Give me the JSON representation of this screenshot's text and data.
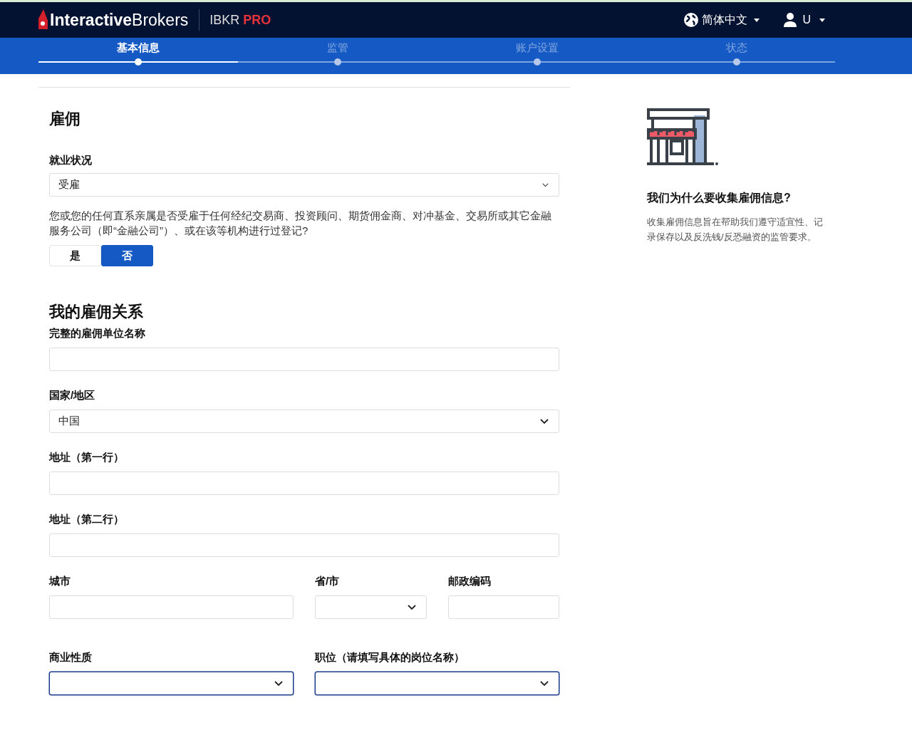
{
  "header": {
    "logo": {
      "part1": "Interactive",
      "part2": "Brokers"
    },
    "product": {
      "name": "IBKR",
      "tier": "PRO"
    },
    "language": "简体中文",
    "user": "U"
  },
  "steps": {
    "progress": {
      "level": 0.25
    },
    "items": [
      {
        "label": "基本信息",
        "selected": true
      },
      {
        "label": "监管",
        "selected": false
      },
      {
        "label": "账户设置",
        "selected": false
      },
      {
        "label": "状态",
        "selected": false
      }
    ]
  },
  "employment": {
    "title": "雇佣",
    "status_label": "就业状况",
    "status_value": "受雇",
    "question": "您或您的任何直系亲属是否受雇于任何经纪交易商、投资顾问、期货佣金商、对冲基金、交易所或其它金融服务公司（即“金融公司”）、或在该等机构进行过登记?",
    "answers": [
      {
        "label": "是",
        "selected": false
      },
      {
        "label": "否",
        "selected": true
      }
    ]
  },
  "relationship": {
    "title": "我的雇佣关系",
    "rows": [
      [
        {
          "label": "完整的雇佣单位名称",
          "kind": "text",
          "highlighted": false
        }
      ],
      [
        {
          "label": "国家/地区",
          "kind": "select",
          "value": "中国",
          "highlighted": false
        }
      ],
      [
        {
          "label": "地址（第一行）",
          "kind": "text",
          "highlighted": false
        }
      ],
      [
        {
          "label": "地址（第二行）",
          "kind": "text",
          "highlighted": false
        }
      ],
      [
        {
          "label": "城市",
          "kind": "text",
          "highlighted": false
        },
        {
          "label": "省/市",
          "kind": "select",
          "highlighted": false
        },
        {
          "label": "邮政编码",
          "kind": "text",
          "highlighted": false
        }
      ],
      [
        {
          "label": "商业性质",
          "kind": "select",
          "highlighted": true
        },
        {
          "label": "职位（请填写具体的岗位名称）",
          "kind": "select",
          "highlighted": true
        }
      ]
    ]
  },
  "aside": {
    "title": "我们为什么要收集雇佣信息?",
    "text": "收集雇佣信息旨在帮助我们遵守适宜性、记录保存以及反洗钱/反恐融资的监管要求。"
  }
}
